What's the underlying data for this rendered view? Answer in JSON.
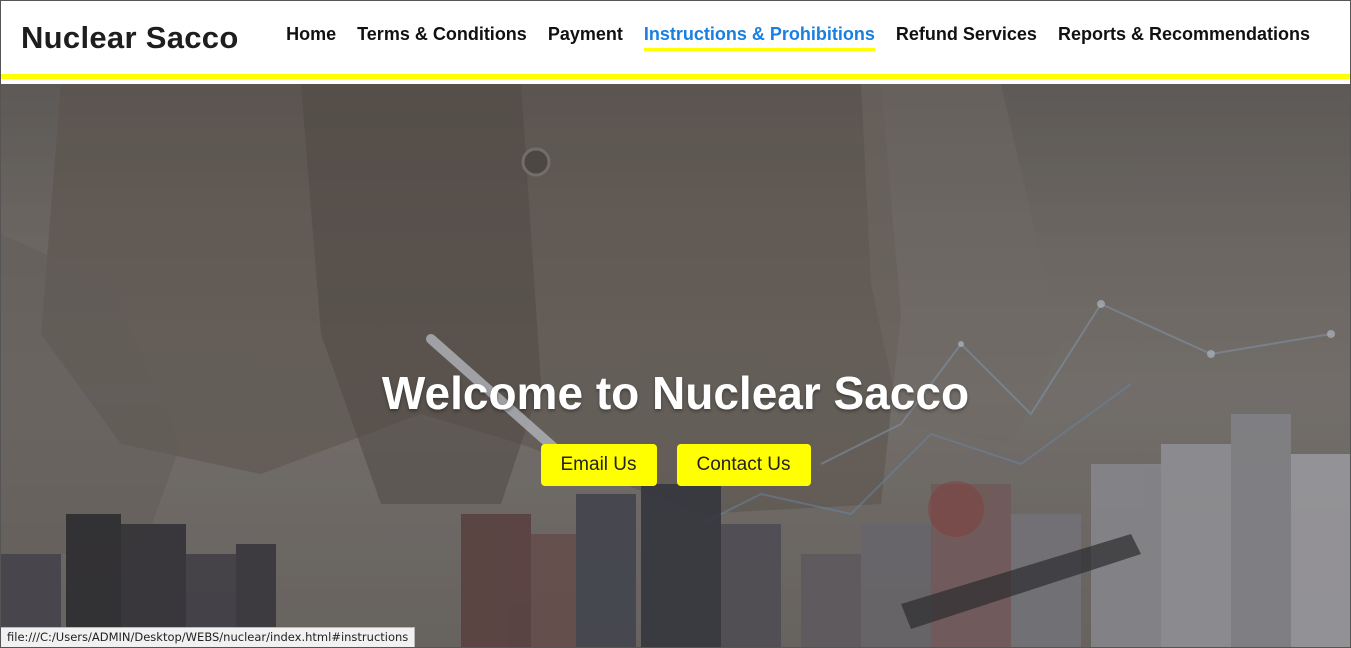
{
  "brand": "Nuclear Sacco",
  "nav": {
    "items": [
      {
        "label": "Home",
        "active": false
      },
      {
        "label": "Terms & Conditions",
        "active": false
      },
      {
        "label": "Payment",
        "active": false
      },
      {
        "label": "Instructions & Prohibitions",
        "active": true
      },
      {
        "label": "Refund Services",
        "active": false
      },
      {
        "label": "Reports & Recommendations",
        "active": false
      }
    ]
  },
  "hero": {
    "title": "Welcome to Nuclear Sacco",
    "email_button": "Email Us",
    "contact_button": "Contact Us"
  },
  "status_url": "file:///C:/Users/ADMIN/Desktop/WEBS/nuclear/index.html#instructions",
  "colors": {
    "accent_yellow": "#ffff00",
    "active_link_blue": "#1a7fe0",
    "brand_text": "#1e1e1e"
  }
}
